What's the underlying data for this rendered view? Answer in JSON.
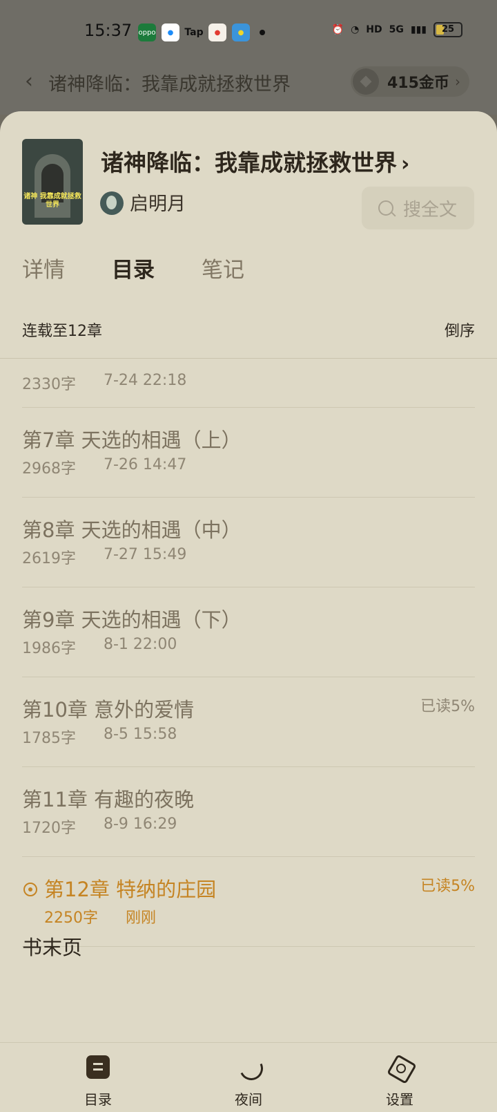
{
  "status_bar": {
    "time": "15:37",
    "battery": "25",
    "network": "5G",
    "hd": "HD",
    "app_icons": [
      "oppo",
      "Tap"
    ]
  },
  "nav": {
    "title": "诸神降临：我靠成就拯救世界",
    "coins": "415金币"
  },
  "book": {
    "title": "诸神降临：我靠成就拯救世界",
    "author": "启明月",
    "cover_text": "诸神\n我靠成就拯救世界",
    "search_label": "搜全文"
  },
  "tabs": [
    "详情",
    "目录",
    "笔记"
  ],
  "summary": {
    "left": "连载至12章",
    "right": "倒序"
  },
  "chapters": [
    {
      "title": "",
      "words": "2330字",
      "time": "7-24 22:18",
      "read": ""
    },
    {
      "title": "第7章 天选的相遇（上）",
      "words": "2968字",
      "time": "7-26 14:47",
      "read": ""
    },
    {
      "title": "第8章 天选的相遇（中）",
      "words": "2619字",
      "time": "7-27 15:49",
      "read": ""
    },
    {
      "title": "第9章 天选的相遇（下）",
      "words": "1986字",
      "time": "8-1 22:00",
      "read": ""
    },
    {
      "title": "第10章 意外的爱情",
      "words": "1785字",
      "time": "8-5 15:58",
      "read": "已读5%"
    },
    {
      "title": "第11章 有趣的夜晚",
      "words": "1720字",
      "time": "8-9 16:29",
      "read": ""
    },
    {
      "title": "第12章 特纳的庄园",
      "words": "2250字",
      "time": "刚刚",
      "read": "已读5%"
    }
  ],
  "book_end": "书末页",
  "bottom_nav": [
    "目录",
    "夜间",
    "设置"
  ]
}
